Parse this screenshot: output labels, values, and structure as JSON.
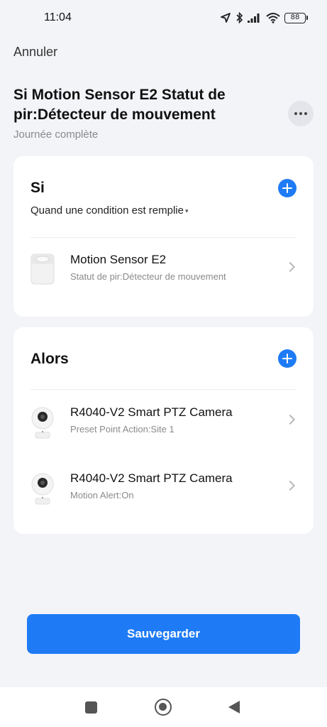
{
  "status_bar": {
    "time": "11:04",
    "battery": "88"
  },
  "header": {
    "cancel_label": "Annuler",
    "title": "Si Motion Sensor E2 Statut de pir:Détecteur de mouvement",
    "subtitle": "Journée complète"
  },
  "if_section": {
    "heading": "Si",
    "condition": "Quand une condition est remplie",
    "items": [
      {
        "title": "Motion Sensor E2",
        "subtitle": "Statut de pir:Détecteur de mouvement",
        "icon": "motion-sensor"
      }
    ]
  },
  "then_section": {
    "heading": "Alors",
    "items": [
      {
        "title": "R4040-V2 Smart PTZ Camera",
        "subtitle": "Preset Point Action:Site 1",
        "icon": "ptz-camera"
      },
      {
        "title": "R4040-V2 Smart PTZ Camera",
        "subtitle": "Motion Alert:On",
        "icon": "ptz-camera"
      }
    ]
  },
  "footer": {
    "save_label": "Sauvegarder"
  },
  "colors": {
    "accent": "#1e7bf5",
    "background": "#f3f4f8"
  }
}
